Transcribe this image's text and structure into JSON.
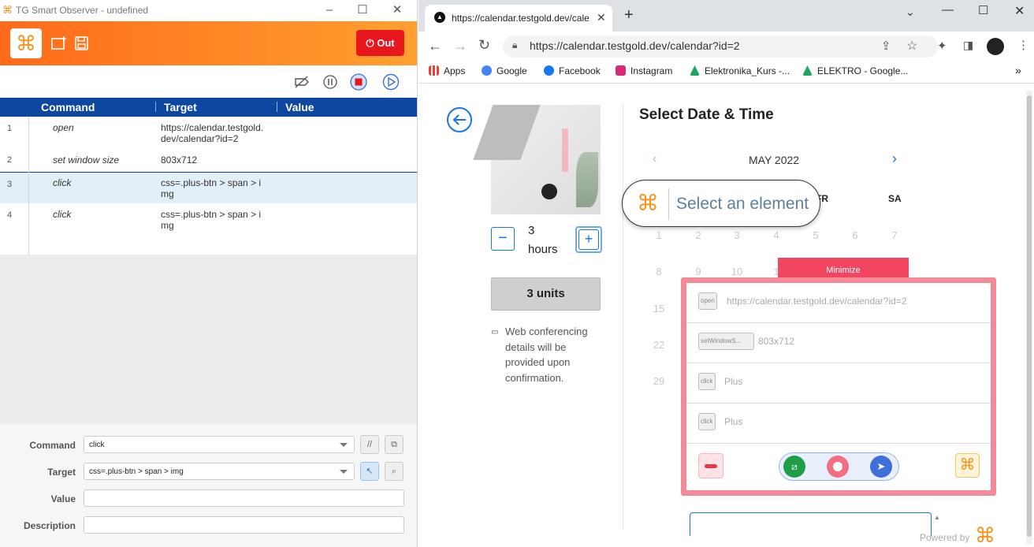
{
  "left_app": {
    "title": "TG Smart Observer - undefined",
    "out_label": "Out",
    "table": {
      "headers": [
        "Command",
        "Target",
        "Value"
      ],
      "rows": [
        {
          "num": "1",
          "command": "open",
          "target": "https://calendar.testgold.dev/calendar?id=2"
        },
        {
          "num": "2",
          "command": "set window size",
          "target": "803x712"
        },
        {
          "num": "3",
          "command": "click",
          "target": "css=.plus-btn > span > img"
        },
        {
          "num": "4",
          "command": "click",
          "target": "css=.plus-btn > span > img"
        }
      ]
    },
    "editor": {
      "command_label": "Command",
      "command_value": "click",
      "target_label": "Target",
      "target_value": "css=.plus-btn > span > img",
      "value_label": "Value",
      "description_label": "Description"
    }
  },
  "browser": {
    "tab_title": "https://calendar.testgold.dev/cale",
    "url": "https://calendar.testgold.dev/calendar?id=2",
    "bookmarks": [
      "Apps",
      "Google",
      "Facebook",
      "Instagram",
      "Elektronika_Kurs -...",
      "ELEKTRO - Google..."
    ],
    "bookmark_colors": [
      "#e94235",
      "#4285f4",
      "#1877f2",
      "#d62976",
      "#1fa463",
      "#1fa463"
    ]
  },
  "calendar_page": {
    "hours_value": "3",
    "hours_unit": "hours",
    "units_button": "3 units",
    "conferencing_note": "Web conferencing details will be provided upon confirmation.",
    "heading": "Select Date & Time",
    "month": "MAY 2022",
    "weekday_visible": [
      "FR",
      "SA"
    ],
    "week_rows": [
      [
        "1",
        "2",
        "3",
        "4",
        "5",
        "6",
        "7"
      ],
      [
        "8",
        "9",
        "10",
        "1"
      ],
      [
        "15"
      ],
      [
        "22"
      ],
      [
        "29"
      ]
    ]
  },
  "recorder_overlay": {
    "select_element_label": "Select an element",
    "minimize_label": "Minimize",
    "steps": [
      {
        "chip": "open",
        "text": "https://calendar.testgold.dev/calendar?id=2"
      },
      {
        "chip": "setWindowS...",
        "text": "803x712"
      },
      {
        "chip": "click",
        "text": "Plus"
      },
      {
        "chip": "click",
        "text": "Plus"
      }
    ],
    "powered_by": "Powered by"
  },
  "colors": {
    "accent_blue": "#0d47a1",
    "brand_orange": "#f7941d",
    "out_red": "#e8171e",
    "popup_border": "#f48a97",
    "minimize_red": "#f24560"
  },
  "icons": [
    "cmd-logo-icon",
    "new-file-icon",
    "save-icon",
    "power-icon",
    "no-breakpoint-icon",
    "pause-icon",
    "record-stop-icon",
    "play-icon",
    "comment-icon",
    "open-icon",
    "pick-target-icon",
    "find-icon",
    "back-arrow-icon",
    "minus-icon",
    "plus-icon",
    "video-icon",
    "chevron-left-icon",
    "chevron-right-icon",
    "delete-icon",
    "screenshot-icon",
    "record-icon",
    "send-icon"
  ]
}
